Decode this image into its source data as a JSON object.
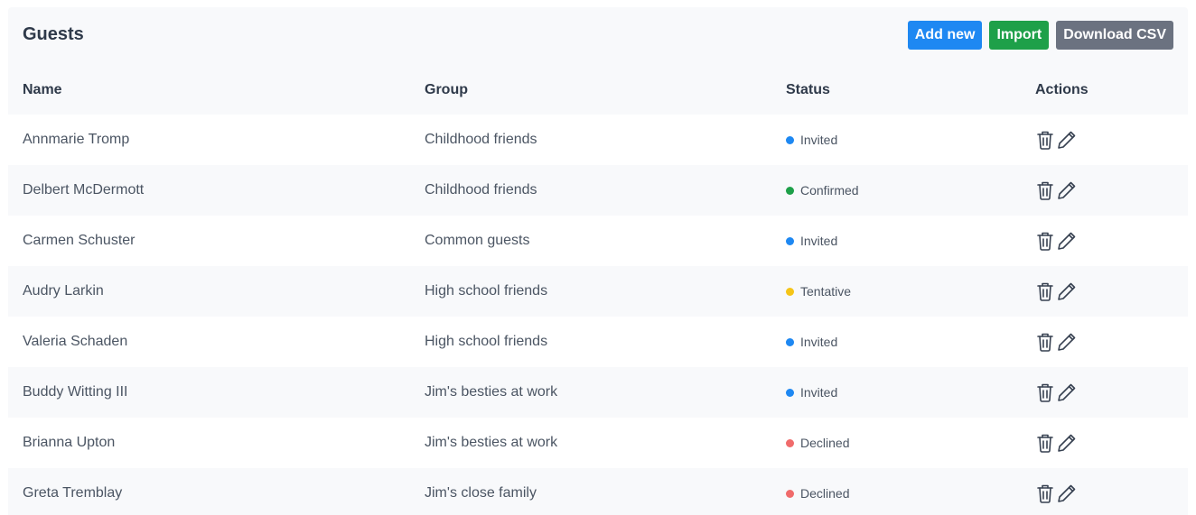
{
  "header": {
    "title": "Guests",
    "buttons": {
      "add_new": "Add new",
      "import": "Import",
      "download_csv": "Download CSV"
    }
  },
  "table": {
    "columns": {
      "name": "Name",
      "group": "Group",
      "status": "Status",
      "actions": "Actions"
    },
    "rows": [
      {
        "name": "Annmarie Tromp",
        "group": "Childhood friends",
        "status": "Invited",
        "status_color": "#1e88f2"
      },
      {
        "name": "Delbert McDermott",
        "group": "Childhood friends",
        "status": "Confirmed",
        "status_color": "#1ea049"
      },
      {
        "name": "Carmen Schuster",
        "group": "Common guests",
        "status": "Invited",
        "status_color": "#1e88f2"
      },
      {
        "name": "Audry Larkin",
        "group": "High school friends",
        "status": "Tentative",
        "status_color": "#f5c518"
      },
      {
        "name": "Valeria Schaden",
        "group": "High school friends",
        "status": "Invited",
        "status_color": "#1e88f2"
      },
      {
        "name": "Buddy Witting III",
        "group": "Jim's besties at work",
        "status": "Invited",
        "status_color": "#1e88f2"
      },
      {
        "name": "Brianna Upton",
        "group": "Jim's besties at work",
        "status": "Declined",
        "status_color": "#f06b6b"
      },
      {
        "name": "Greta Tremblay",
        "group": "Jim's close family",
        "status": "Declined",
        "status_color": "#f06b6b"
      }
    ],
    "row_icons": [
      "trash-icon",
      "pencil-icon"
    ]
  },
  "colors": {
    "primary": "#1e88f2",
    "success": "#1ea049",
    "neutral": "#6b7280"
  }
}
